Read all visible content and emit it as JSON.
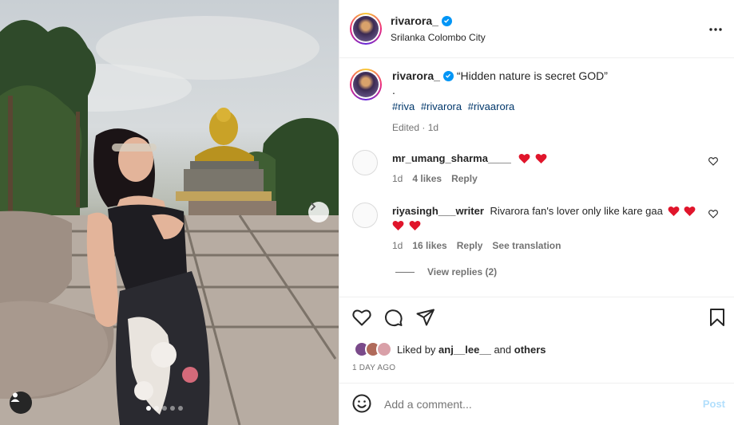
{
  "post": {
    "username": "rivarora_",
    "location": "Srilanka Colombo City"
  },
  "caption": {
    "username": "rivarora_",
    "text": "“Hidden nature is secret GOD”",
    "dot": ".",
    "hashtags": [
      "#riva",
      "#rivarora",
      "#rivaarora"
    ],
    "edited": "Edited · 1d"
  },
  "comments": [
    {
      "username": "mr_umang_sharma____",
      "text": "",
      "hearts": 2,
      "time": "1d",
      "likes": "4 likes",
      "reply": "Reply"
    },
    {
      "username": "riyasingh___writer",
      "text": "Rivarora fan's lover only like kare gaa",
      "hearts": 4,
      "time": "1d",
      "likes": "16 likes",
      "reply": "Reply",
      "translate": "See translation"
    }
  ],
  "view_replies": "View replies (2)",
  "likes": {
    "prefix": "Liked by ",
    "user": "anj__lee__",
    "middle": " and ",
    "others": "others"
  },
  "time_ago": "1 DAY AGO",
  "add_comment": {
    "placeholder": "Add a comment...",
    "post": "Post"
  },
  "colors": {
    "verified": "#0095f6",
    "heart": "#ff3040",
    "hashtag": "#00376b",
    "post_disabled": "#b2dffc"
  },
  "carousel": {
    "slides": 5,
    "active": 1
  }
}
